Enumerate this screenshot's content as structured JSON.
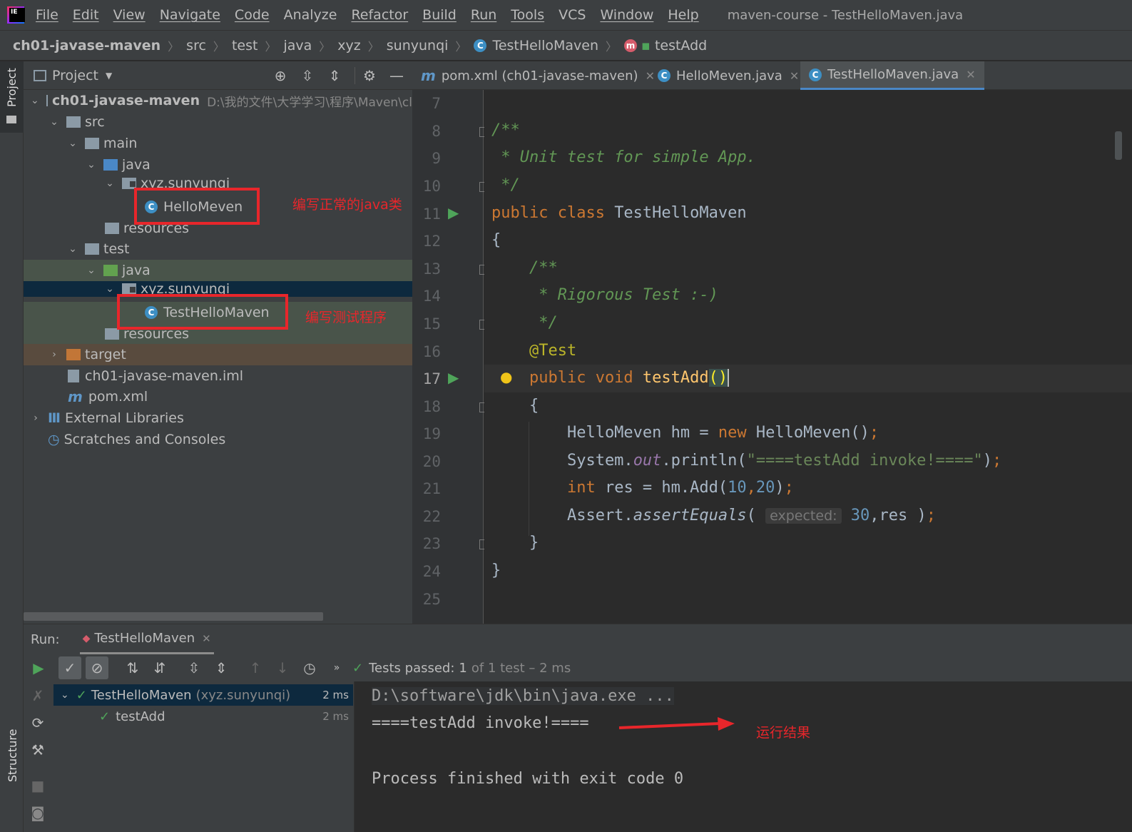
{
  "menu": {
    "items": [
      "File",
      "Edit",
      "View",
      "Navigate",
      "Code",
      "Analyze",
      "Refactor",
      "Build",
      "Run",
      "Tools",
      "VCS",
      "Window",
      "Help"
    ],
    "window_title": "maven-course - TestHelloMaven.java"
  },
  "breadcrumb": [
    "ch01-javase-maven",
    "src",
    "test",
    "java",
    "xyz",
    "sunyunqi",
    "TestHelloMaven",
    "testAdd"
  ],
  "project_panel": {
    "title": "Project",
    "tree": [
      {
        "label": "ch01-javase-maven",
        "extra": "D:\\我的文件\\大学学习\\程序\\Maven\\cl"
      },
      {
        "label": "src"
      },
      {
        "label": "main"
      },
      {
        "label": "java"
      },
      {
        "label": "xyz.sunyunqi"
      },
      {
        "label": "HelloMeven"
      },
      {
        "label": "resources"
      },
      {
        "label": "test"
      },
      {
        "label": "java"
      },
      {
        "label": "xyz.sunyunqi"
      },
      {
        "label": "TestHelloMaven"
      },
      {
        "label": "resources"
      },
      {
        "label": "target"
      },
      {
        "label": "ch01-javase-maven.iml"
      },
      {
        "label": "pom.xml"
      },
      {
        "label": "External Libraries"
      },
      {
        "label": "Scratches and Consoles"
      }
    ]
  },
  "left_stripe": {
    "project": "Project",
    "structure": "Structure"
  },
  "editor": {
    "tabs": [
      "pom.xml (ch01-javase-maven)",
      "HelloMeven.java",
      "TestHelloMaven.java"
    ],
    "line_numbers": [
      "7",
      "8",
      "9",
      "10",
      "11",
      "12",
      "13",
      "14",
      "15",
      "16",
      "17",
      "18",
      "19",
      "20",
      "21",
      "22",
      "23",
      "24",
      "25"
    ],
    "code": {
      "l8": "/**",
      "l9": " * Unit test for simple App.",
      "l10": " */",
      "l11_kw": "public class ",
      "l11_name": "TestHelloMaven",
      "l12": "{",
      "l13": "    /**",
      "l14": "     * Rigorous Test :-)",
      "l15": "     */",
      "l16": "    @Test",
      "l17_kw": "    public void ",
      "l17_fn": "testAdd",
      "l17_end": "()",
      "l18": "    {",
      "l19_a": "        HelloMeven hm = ",
      "l19_kw": "new",
      "l19_b": " HelloMeven()",
      "l20_a": "        System.",
      "l20_fld": "out",
      "l20_b": ".println(",
      "l20_str": "\"====testAdd invoke!====\"",
      "l20_c": ")",
      "l21_kw": "        int",
      "l21_a": " res = hm.Add(",
      "l21_n1": "10",
      "l21_n2": "20",
      "l21_b": ")",
      "l22_a": "        Assert.",
      "l22_m": "assertEquals",
      "l22_b": "( ",
      "l22_hint": "expected:",
      "l22_n": "30",
      "l22_c": ",res )",
      "l23": "    }",
      "l24": "}"
    }
  },
  "run": {
    "label": "Run:",
    "tab": "TestHelloMaven",
    "status_prefix": "Tests passed:",
    "status_count": "1",
    "status_suffix": "of 1 test – 2 ms",
    "tree": [
      {
        "name": "TestHelloMaven",
        "pkg": "(xyz.sunyunqi)",
        "time": "2 ms"
      },
      {
        "name": "testAdd",
        "time": "2 ms"
      }
    ],
    "console": [
      "D:\\software\\jdk\\bin\\java.exe ...",
      "====testAdd invoke!====",
      "",
      "Process finished with exit code 0"
    ]
  },
  "annotations": {
    "normal_class": "编写正常的java类",
    "test_program": "编写测试程序",
    "run_result": "运行结果"
  },
  "colors": {
    "annotation": "#e8262b",
    "pass": "#4fa45a",
    "accent": "#4a88c7"
  }
}
